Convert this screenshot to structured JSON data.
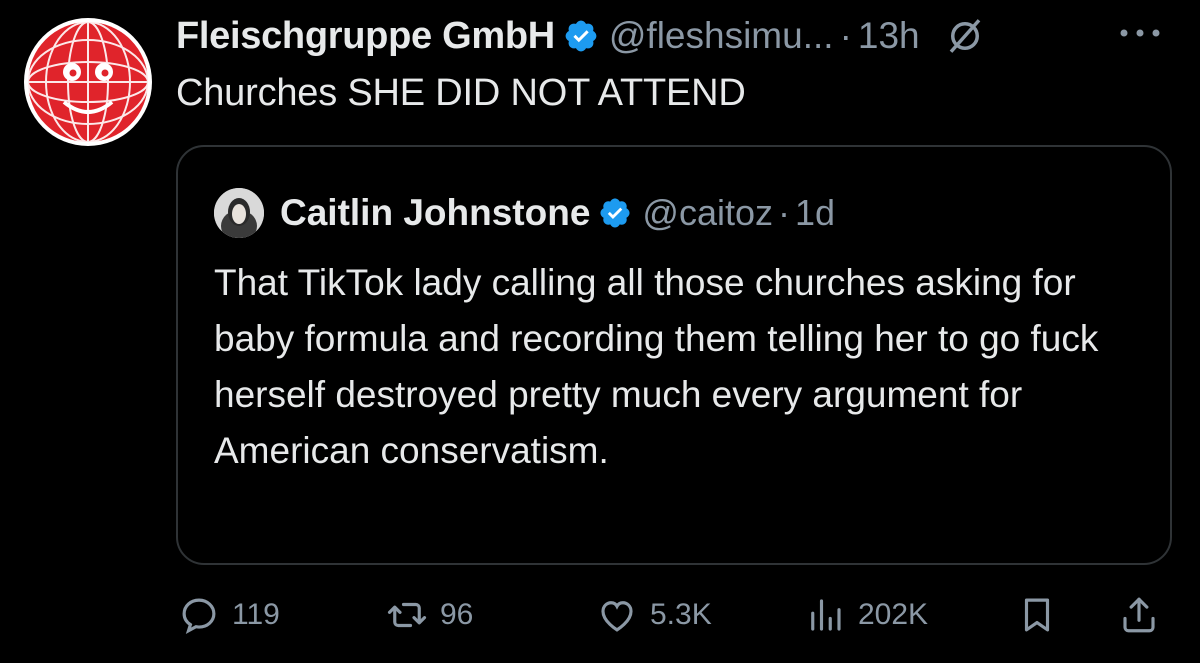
{
  "post": {
    "display_name": "Fleischgruppe GmbH",
    "handle": "@fleshsimu...",
    "separator": "·",
    "time": "13h",
    "text": "Churches SHE DID NOT ATTEND",
    "avatar_icon": "red-globe-face-avatar",
    "verified_icon": "verified-badge-icon",
    "grok_icon": "grok-icon",
    "more_icon": "more-icon"
  },
  "quote": {
    "display_name": "Caitlin Johnstone",
    "handle": "@caitoz",
    "separator": "·",
    "time": "1d",
    "text": "That TikTok lady calling all those churches asking for baby formula and recording them telling her to go fuck herself destroyed pretty much every argument for American conservatism."
  },
  "actions": {
    "replies": "119",
    "reposts": "96",
    "likes": "5.3K",
    "views": "202K"
  },
  "colors": {
    "background": "#000000",
    "text": "#e7e9ea",
    "secondary_text": "#8b98a5",
    "verified_blue": "#1d9bf0",
    "border": "#2f3336",
    "avatar_red": "#e0242b"
  }
}
